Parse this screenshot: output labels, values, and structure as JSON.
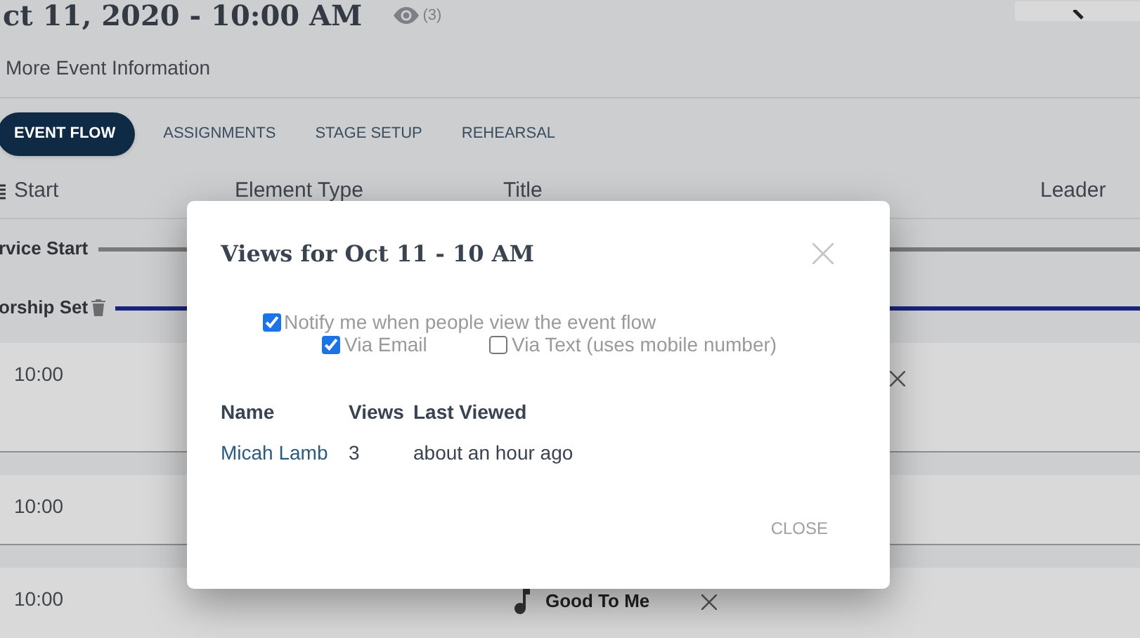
{
  "header": {
    "title": "ct 11, 2020 - 10:00 AM",
    "view_count": "(3)",
    "link": "More Event Information"
  },
  "tabs": [
    {
      "label": "EVENT FLOW",
      "selected": true
    },
    {
      "label": "ASSIGNMENTS",
      "selected": false
    },
    {
      "label": "STAGE SETUP",
      "selected": false
    },
    {
      "label": "REHEARSAL",
      "selected": false
    }
  ],
  "columns": [
    "Start",
    "Element Type",
    "Title",
    "Leader"
  ],
  "sections": [
    {
      "label": "rvice Start",
      "color": "#7a7a7a",
      "deletable": false
    },
    {
      "label": "orship Set",
      "color": "#1a237e",
      "deletable": true
    }
  ],
  "rows": [
    {
      "time": "10:00",
      "title": "",
      "removable": true
    },
    {
      "time": "10:00",
      "title": "",
      "removable": false
    },
    {
      "time": "10:00",
      "title": "Good To Me",
      "removable": true
    }
  ],
  "dialog": {
    "title": "Views for Oct 11 - 10 AM",
    "notify": {
      "label": "Notify me when people view the event flow",
      "checked": true
    },
    "options": [
      {
        "label": "Via Email",
        "checked": true
      },
      {
        "label": "Via Text (uses mobile number)",
        "checked": false
      }
    ],
    "columns": [
      "Name",
      "Views",
      "Last Viewed"
    ],
    "viewers": [
      {
        "name": "Micah Lamb",
        "views": "3",
        "last_viewed": "about an hour ago"
      }
    ],
    "close_button": "CLOSE"
  }
}
